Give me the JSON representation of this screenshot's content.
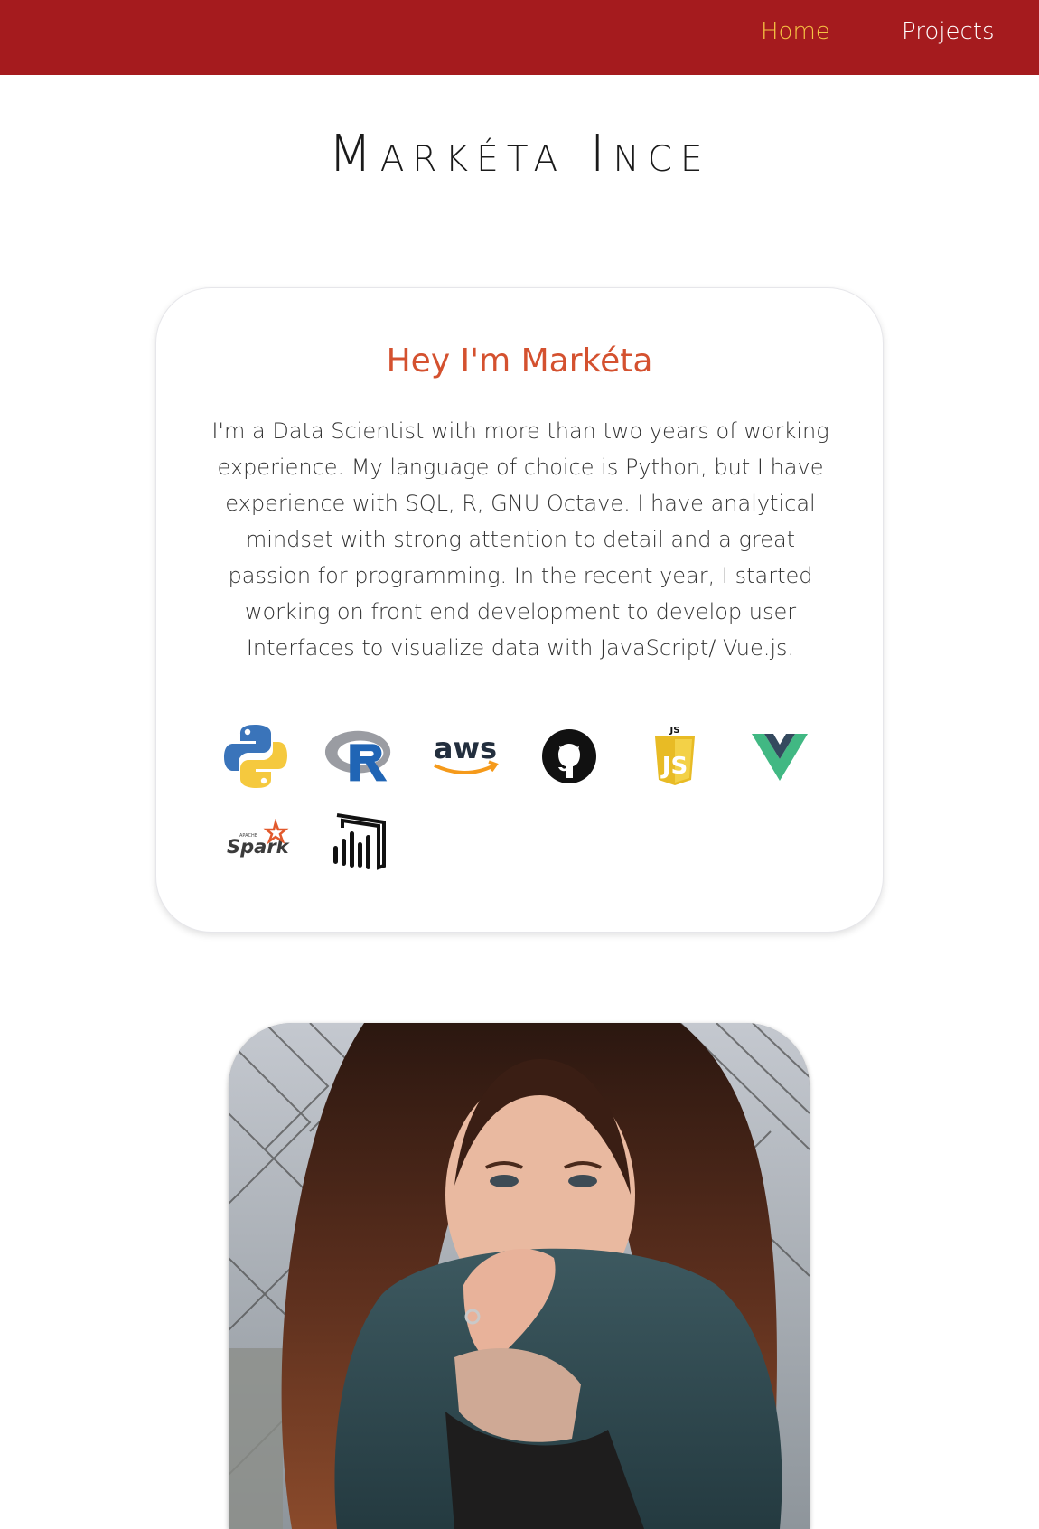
{
  "nav": {
    "items": [
      {
        "label": "Home",
        "active": true
      },
      {
        "label": "Projects",
        "active": false
      }
    ],
    "background": "#a51b1e",
    "active_color": "#f6c443"
  },
  "header": {
    "title": "Markéta Ince"
  },
  "about": {
    "heading": "Hey I'm Markéta",
    "body": "I'm a Data Scientist with more than two years of working experience. My language of choice is Python, but I have experience with SQL, R, GNU Octave. I have analytical mindset with strong attention to detail and a great passion for programming. In the recent year, I started working on front end development to develop user Interfaces to visualize data with JavaScript/ Vue.js.",
    "heading_color": "#d4512f",
    "skills_icons": [
      "python-icon",
      "r-icon",
      "aws-icon",
      "github-icon",
      "javascript-icon",
      "vue-icon",
      "spark-icon",
      "power-bi-icon"
    ],
    "aws_text": "aws",
    "js_top_text": "JS",
    "js_badge_text": "JS",
    "spark_small_text": "APACHE",
    "spark_text": "Spark"
  },
  "profile_photo": {
    "present": true
  }
}
